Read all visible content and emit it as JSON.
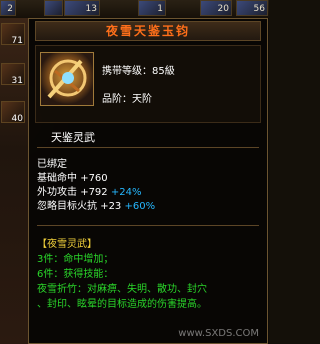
{
  "top_bar": {
    "slots": [
      {
        "count": "2"
      },
      {
        "count": ""
      },
      {
        "count": "13"
      },
      {
        "count": "1"
      },
      {
        "count": "20"
      },
      {
        "count": "56"
      }
    ]
  },
  "left_bar": {
    "slots": [
      {
        "count": "71"
      },
      {
        "count": "31"
      },
      {
        "count": "40"
      }
    ]
  },
  "item": {
    "name": "夜雪天鉴玉钧",
    "level_line": "携带等级：85級",
    "grade_line": "品阶：天阶",
    "subtitle": "天鉴灵武",
    "status": "已绑定"
  },
  "stats": [
    {
      "label": "基础命中",
      "value": "+760",
      "bonus": ""
    },
    {
      "label": "外功攻击",
      "value": "+792",
      "bonus": "+24%"
    },
    {
      "label": "忽略目标火抗",
      "value": "+23",
      "bonus": "+60%"
    }
  ],
  "set": {
    "name": "【夜雪灵武】",
    "lines": [
      "3件：命中增加；",
      "6件：获得技能：",
      "夜雪折竹：对麻痹、失明、散功、封穴",
      "、封印、眩晕的目标造成的伤害提高。"
    ]
  },
  "watermark": "www.SXDS.COM",
  "colors": {
    "item_name": "#ff6f1a",
    "text": "#ffffff",
    "bonus": "#26b8ff",
    "set_name": "#f2d13b",
    "set_text": "#2ad62a",
    "border": "#6b5430"
  }
}
